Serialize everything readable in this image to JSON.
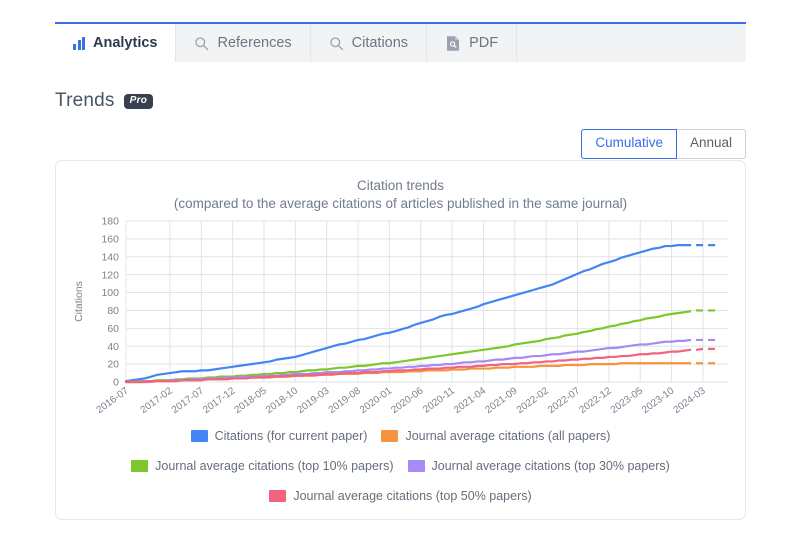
{
  "tabs": [
    {
      "label": "Analytics",
      "icon": "bar-chart-icon",
      "active": true
    },
    {
      "label": "References",
      "icon": "search-icon",
      "active": false
    },
    {
      "label": "Citations",
      "icon": "search-icon",
      "active": false
    },
    {
      "label": "PDF",
      "icon": "pdf-document-icon",
      "active": false
    }
  ],
  "section": {
    "title": "Trends",
    "badge": "Pro"
  },
  "toggle": {
    "options": [
      "Cumulative",
      "Annual"
    ],
    "selected": "Cumulative"
  },
  "colors": {
    "blue": "#4285f4",
    "orange": "#f5943c",
    "green": "#7dc72b",
    "purple": "#a78bf5",
    "pink": "#f2637f",
    "accent": "#3b6fe8",
    "grid": "#e0e3e7",
    "axis_text": "#7a838f",
    "card_border": "#e4e7eb"
  },
  "chart_data": {
    "type": "line",
    "title": "Citation trends",
    "subtitle": "(compared to the average citations of articles published in the same journal)",
    "xlabel": "",
    "ylabel": "Citations",
    "ylim": [
      0,
      180
    ],
    "ytick_step": 20,
    "yticks": [
      0,
      20,
      40,
      60,
      80,
      100,
      120,
      140,
      160,
      180
    ],
    "grid": true,
    "legend_position": "bottom",
    "xticks": [
      "2016-07",
      "2017-02",
      "2017-07",
      "2017-12",
      "2018-05",
      "2018-10",
      "2019-03",
      "2019-08",
      "2020-01",
      "2020-06",
      "2020-11",
      "2021-04",
      "2021-09",
      "2022-02",
      "2022-07",
      "2022-12",
      "2023-05",
      "2023-10",
      "2024-03"
    ],
    "x": [
      "2016-07",
      "2016-08",
      "2016-09",
      "2016-10",
      "2016-11",
      "2016-12",
      "2017-01",
      "2017-02",
      "2017-03",
      "2017-04",
      "2017-05",
      "2017-06",
      "2017-07",
      "2017-08",
      "2017-09",
      "2017-10",
      "2017-11",
      "2017-12",
      "2018-01",
      "2018-02",
      "2018-03",
      "2018-04",
      "2018-05",
      "2018-06",
      "2018-07",
      "2018-08",
      "2018-09",
      "2018-10",
      "2018-11",
      "2018-12",
      "2019-01",
      "2019-02",
      "2019-03",
      "2019-04",
      "2019-05",
      "2019-06",
      "2019-07",
      "2019-08",
      "2019-09",
      "2019-10",
      "2019-11",
      "2019-12",
      "2020-01",
      "2020-02",
      "2020-03",
      "2020-04",
      "2020-05",
      "2020-06",
      "2020-07",
      "2020-08",
      "2020-09",
      "2020-10",
      "2020-11",
      "2020-12",
      "2021-01",
      "2021-02",
      "2021-03",
      "2021-04",
      "2021-05",
      "2021-06",
      "2021-07",
      "2021-08",
      "2021-09",
      "2021-10",
      "2021-11",
      "2021-12",
      "2022-01",
      "2022-02",
      "2022-03",
      "2022-04",
      "2022-05",
      "2022-06",
      "2022-07",
      "2022-08",
      "2022-09",
      "2022-10",
      "2022-11",
      "2022-12",
      "2023-01",
      "2023-02",
      "2023-03",
      "2023-04",
      "2023-05",
      "2023-06",
      "2023-07",
      "2023-08",
      "2023-09",
      "2023-10",
      "2023-11",
      "2023-12",
      "2024-01",
      "2024-02",
      "2024-03",
      "2024-04",
      "2024-05",
      "2024-06",
      "2024-07"
    ],
    "dashed_from_index": 89,
    "series": [
      {
        "name": "Citations (for current paper)",
        "color": "#4285f4",
        "values": [
          1,
          2,
          3,
          4,
          6,
          8,
          9,
          10,
          11,
          12,
          12,
          12,
          13,
          13,
          14,
          15,
          16,
          17,
          18,
          19,
          20,
          21,
          22,
          23,
          25,
          26,
          27,
          28,
          30,
          32,
          34,
          36,
          38,
          40,
          42,
          43,
          45,
          47,
          48,
          50,
          52,
          54,
          55,
          57,
          59,
          61,
          64,
          66,
          68,
          70,
          73,
          75,
          76,
          78,
          80,
          82,
          84,
          87,
          89,
          91,
          93,
          95,
          97,
          99,
          101,
          103,
          105,
          107,
          109,
          112,
          115,
          118,
          121,
          124,
          126,
          129,
          132,
          134,
          136,
          139,
          141,
          143,
          145,
          147,
          149,
          150,
          152,
          152,
          153,
          153,
          153,
          153,
          153,
          153,
          153
        ]
      },
      {
        "name": "Journal average citations (all papers)",
        "color": "#f5943c",
        "values": [
          0,
          0,
          0,
          0,
          0,
          1,
          1,
          1,
          1,
          2,
          2,
          2,
          2,
          3,
          3,
          3,
          3,
          4,
          4,
          4,
          5,
          5,
          5,
          5,
          6,
          6,
          6,
          7,
          7,
          7,
          7,
          8,
          8,
          8,
          9,
          9,
          9,
          9,
          10,
          10,
          10,
          11,
          11,
          11,
          11,
          12,
          12,
          12,
          13,
          13,
          13,
          13,
          14,
          14,
          14,
          15,
          15,
          15,
          15,
          16,
          16,
          16,
          17,
          17,
          17,
          17,
          18,
          18,
          18,
          18,
          19,
          19,
          19,
          19,
          20,
          20,
          20,
          20,
          20,
          21,
          21,
          21,
          21,
          21,
          21,
          21,
          21,
          21,
          21,
          21,
          21,
          21,
          21,
          21,
          21
        ]
      },
      {
        "name": "Journal average citations (top 10% papers)",
        "color": "#7dc72b",
        "values": [
          0,
          0,
          1,
          1,
          1,
          2,
          2,
          2,
          3,
          3,
          4,
          4,
          4,
          5,
          5,
          6,
          6,
          6,
          7,
          7,
          8,
          8,
          9,
          9,
          10,
          10,
          11,
          11,
          12,
          13,
          13,
          14,
          14,
          15,
          16,
          16,
          17,
          18,
          18,
          19,
          20,
          21,
          21,
          22,
          23,
          24,
          25,
          26,
          27,
          28,
          29,
          30,
          31,
          32,
          33,
          34,
          35,
          36,
          37,
          38,
          39,
          40,
          42,
          43,
          44,
          45,
          46,
          48,
          49,
          50,
          52,
          53,
          54,
          56,
          57,
          59,
          60,
          62,
          63,
          65,
          66,
          68,
          69,
          71,
          72,
          73,
          75,
          76,
          77,
          78,
          79,
          80,
          80,
          80,
          80
        ]
      },
      {
        "name": "Journal average citations (top 30% papers)",
        "color": "#a78bf5",
        "values": [
          0,
          0,
          0,
          1,
          1,
          1,
          1,
          2,
          2,
          2,
          3,
          3,
          3,
          4,
          4,
          4,
          5,
          5,
          5,
          6,
          6,
          6,
          7,
          7,
          7,
          8,
          8,
          9,
          9,
          9,
          10,
          10,
          11,
          11,
          11,
          12,
          12,
          13,
          13,
          14,
          14,
          15,
          15,
          16,
          16,
          17,
          17,
          18,
          18,
          19,
          19,
          20,
          20,
          21,
          22,
          22,
          23,
          23,
          24,
          25,
          25,
          26,
          27,
          27,
          28,
          29,
          29,
          30,
          31,
          31,
          32,
          33,
          34,
          34,
          35,
          36,
          37,
          38,
          38,
          39,
          40,
          41,
          42,
          42,
          43,
          44,
          45,
          45,
          46,
          46,
          47,
          47,
          47,
          47,
          47
        ]
      },
      {
        "name": "Journal average citations (top 50% papers)",
        "color": "#f2637f",
        "values": [
          0,
          0,
          0,
          0,
          1,
          1,
          1,
          1,
          1,
          2,
          2,
          2,
          2,
          3,
          3,
          3,
          3,
          4,
          4,
          4,
          5,
          5,
          5,
          6,
          6,
          6,
          7,
          7,
          7,
          8,
          8,
          8,
          9,
          9,
          9,
          10,
          10,
          10,
          11,
          11,
          11,
          12,
          12,
          13,
          13,
          13,
          14,
          14,
          15,
          15,
          15,
          16,
          16,
          17,
          17,
          17,
          18,
          18,
          19,
          19,
          20,
          20,
          20,
          21,
          21,
          22,
          22,
          23,
          23,
          24,
          24,
          25,
          25,
          26,
          26,
          27,
          27,
          28,
          28,
          29,
          29,
          30,
          31,
          31,
          32,
          32,
          33,
          34,
          34,
          35,
          36,
          36,
          37,
          37,
          37
        ]
      }
    ]
  }
}
